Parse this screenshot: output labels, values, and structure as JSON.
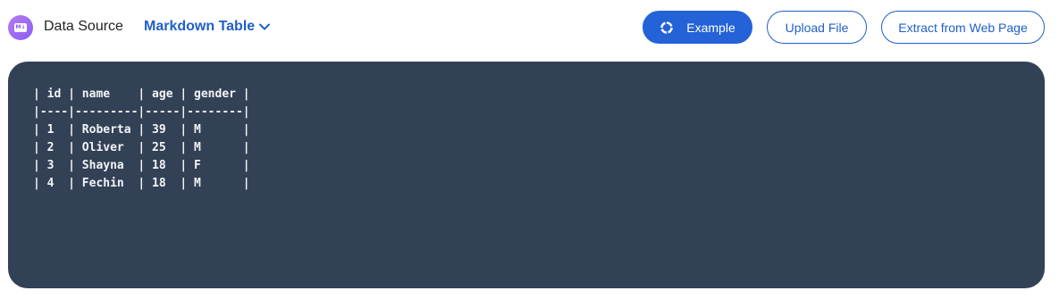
{
  "header": {
    "logo_text": "M↓",
    "data_source_label": "Data Source",
    "format_selected": "Markdown Table",
    "buttons": {
      "example": "Example",
      "upload": "Upload File",
      "extract": "Extract from Web Page"
    }
  },
  "editor": {
    "content": "| id | name    | age | gender |\n|----|---------|-----|--------|\n| 1  | Roberta | 39  | M      |\n| 2  | Oliver  | 25  | M      |\n| 3  | Shayna  | 18  | F      |\n| 4  | Fechin  | 18  | M      |"
  },
  "colors": {
    "accent": "#2462d8",
    "editor_bg": "#334156",
    "logo": "#8b5cf6"
  },
  "icons": {
    "logo": "markdown-logo-icon",
    "format_chevron": "chevron-down-icon",
    "example": "refresh-icon"
  }
}
